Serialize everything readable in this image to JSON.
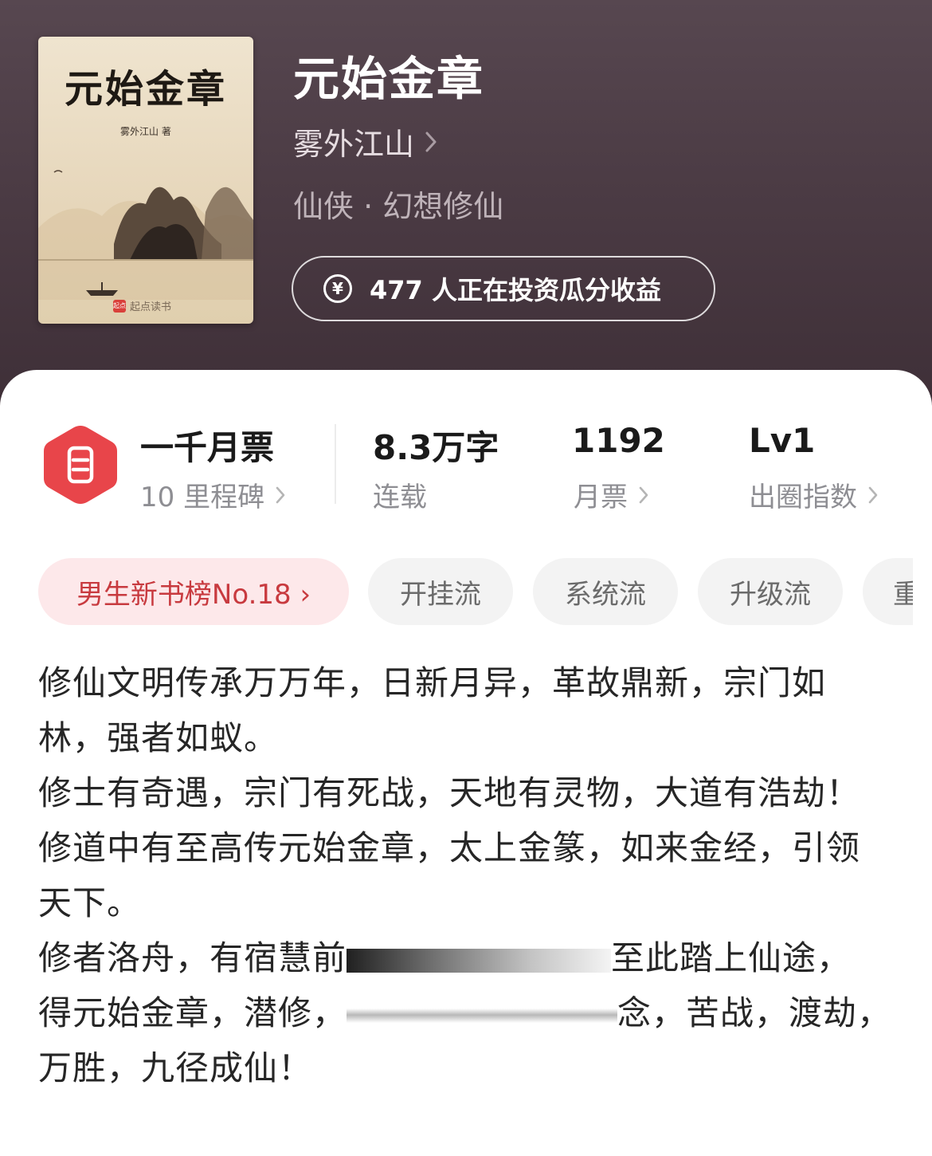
{
  "book": {
    "cover_title": "元始金章",
    "cover_author": "雾外江山 著",
    "cover_logo": "起点读书",
    "cover_logo_mark": "起点",
    "title": "元始金章",
    "author": "雾外江山",
    "genre": "仙侠 · 幻想修仙",
    "invest_text": "477 人正在投资瓜分收益",
    "invest_icon": "¥"
  },
  "stats": [
    {
      "value": "一千月票",
      "label": "10 里程碑",
      "icon": "ticket-icon"
    },
    {
      "value": "8.3万字",
      "label": "连载"
    },
    {
      "value": "1192",
      "label": "月票"
    },
    {
      "value": "Lv1",
      "label": "出圈指数"
    }
  ],
  "tags": [
    {
      "label": "男生新书榜No.18 ›"
    },
    {
      "label": "开挂流"
    },
    {
      "label": "系统流"
    },
    {
      "label": "升级流"
    },
    {
      "label": "重"
    }
  ],
  "intro": {
    "lines": [
      "修仙文明传承万万年，日新月异，革故鼎新，宗门如林，强者如蚁。",
      "修士有奇遇，宗门有死战，天地有灵物，大道有浩劫！",
      "修道中有至高传元始金章，太上金篆，如来金经，引领天下。"
    ],
    "line4_a": "修者洛舟，有宿慧前",
    "line4_b": "至此踏上仙途，",
    "line5_a": "得元始金章，潜修，",
    "line5_b": "念，苦战，渡劫，万胜，九径成仙！"
  },
  "colors": {
    "header_bg": "#4a3a43",
    "badge_red": "#e8454a",
    "rank_tag_text": "#c83a3f",
    "rank_tag_bg": "#fde8ea"
  }
}
